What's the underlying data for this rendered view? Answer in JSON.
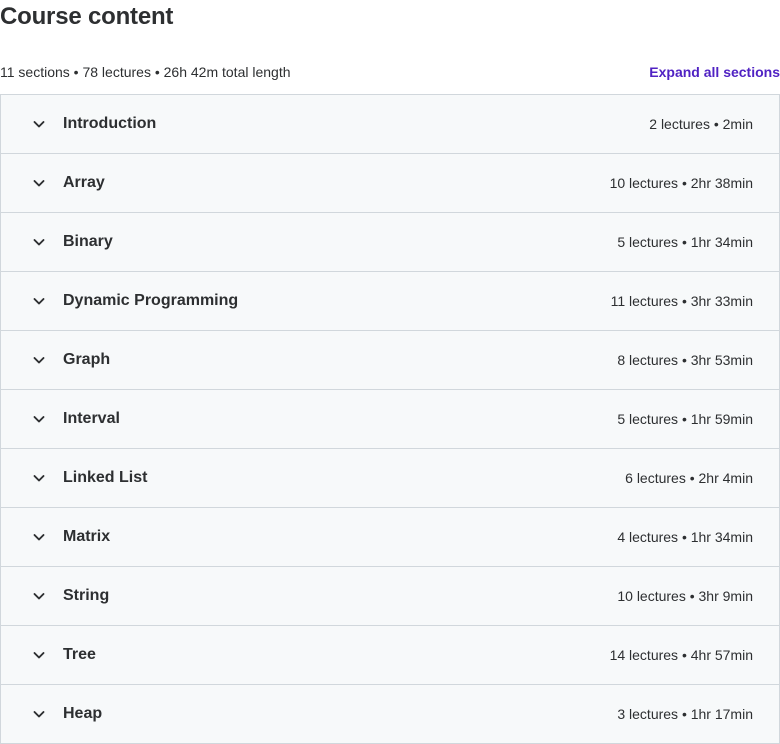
{
  "header": {
    "title": "Course content",
    "summary": "11 sections • 78 lectures • 26h 42m total length",
    "expand_all_label": "Expand all sections"
  },
  "sections": [
    {
      "title": "Introduction",
      "meta": "2 lectures • 2min",
      "icon": "chevron-down-icon"
    },
    {
      "title": "Array",
      "meta": "10 lectures • 2hr 38min",
      "icon": "chevron-down-icon"
    },
    {
      "title": "Binary",
      "meta": "5 lectures • 1hr 34min",
      "icon": "chevron-down-icon"
    },
    {
      "title": "Dynamic Programming",
      "meta": "11 lectures • 3hr 33min",
      "icon": "chevron-down-icon"
    },
    {
      "title": "Graph",
      "meta": "8 lectures • 3hr 53min",
      "icon": "chevron-down-icon"
    },
    {
      "title": "Interval",
      "meta": "5 lectures • 1hr 59min",
      "icon": "chevron-down-icon"
    },
    {
      "title": "Linked List",
      "meta": "6 lectures • 2hr 4min",
      "icon": "chevron-down-icon"
    },
    {
      "title": "Matrix",
      "meta": "4 lectures • 1hr 34min",
      "icon": "chevron-down-icon"
    },
    {
      "title": "String",
      "meta": "10 lectures • 3hr 9min",
      "icon": "chevron-down-icon"
    },
    {
      "title": "Tree",
      "meta": "14 lectures • 4hr 57min",
      "icon": "chevron-down-icon"
    },
    {
      "title": "Heap",
      "meta": "3 lectures • 1hr 17min",
      "icon": "chevron-down-icon"
    }
  ],
  "colors": {
    "text": "#2d2f31",
    "accent": "#5022c3",
    "row_bg": "#f7f9fa",
    "border": "#d1d7dc"
  }
}
